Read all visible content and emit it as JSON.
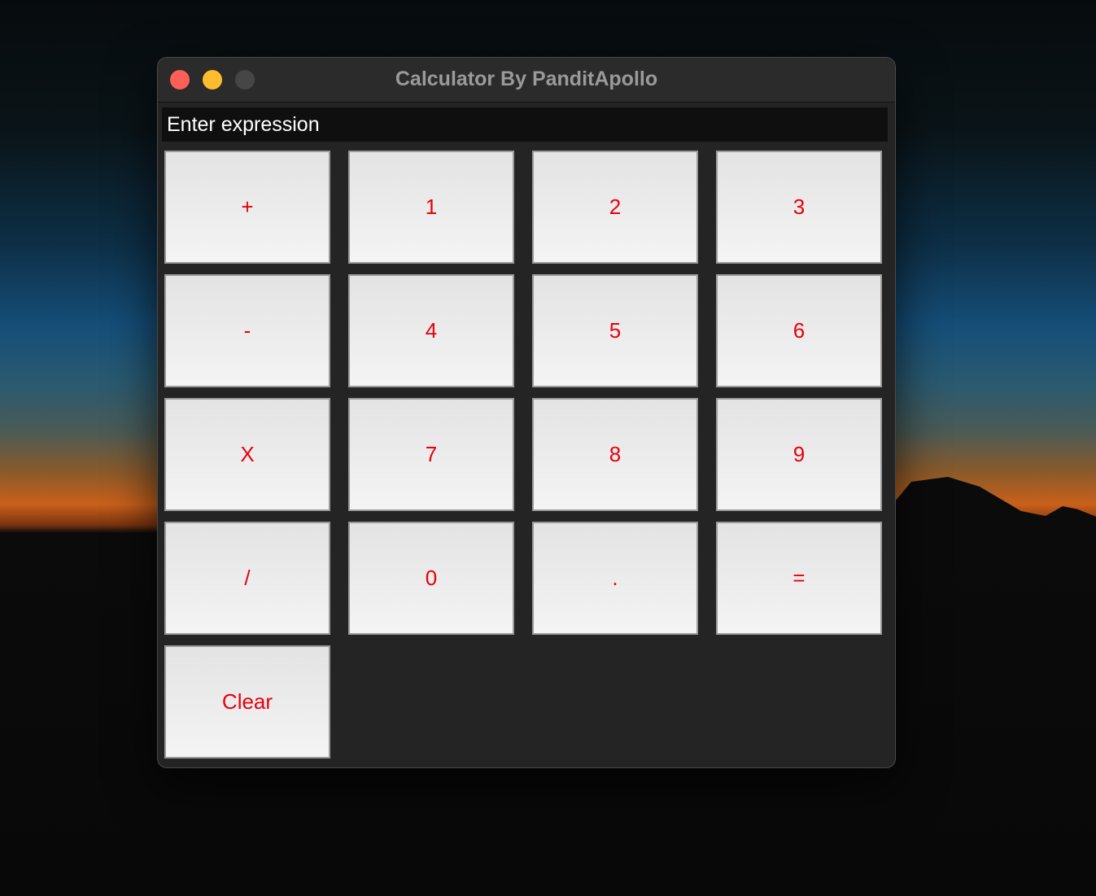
{
  "window": {
    "title": "Calculator By PanditApollo"
  },
  "input": {
    "placeholder": "Enter expression",
    "value": ""
  },
  "buttons": [
    {
      "id": "plus",
      "label": "+"
    },
    {
      "id": "1",
      "label": "1"
    },
    {
      "id": "2",
      "label": "2"
    },
    {
      "id": "3",
      "label": "3"
    },
    {
      "id": "minus",
      "label": "-"
    },
    {
      "id": "4",
      "label": "4"
    },
    {
      "id": "5",
      "label": "5"
    },
    {
      "id": "6",
      "label": "6"
    },
    {
      "id": "multiply",
      "label": "X"
    },
    {
      "id": "7",
      "label": "7"
    },
    {
      "id": "8",
      "label": "8"
    },
    {
      "id": "9",
      "label": "9"
    },
    {
      "id": "divide",
      "label": "/"
    },
    {
      "id": "0",
      "label": "0"
    },
    {
      "id": "decimal",
      "label": "."
    },
    {
      "id": "equals",
      "label": "="
    },
    {
      "id": "clear",
      "label": "Clear"
    }
  ],
  "colors": {
    "button_text": "#e8000b",
    "window_bg": "#242424",
    "input_bg": "#0f0f0f",
    "close": "#fe5f57",
    "minimize": "#febc2e",
    "maximize_disabled": "#464646"
  }
}
